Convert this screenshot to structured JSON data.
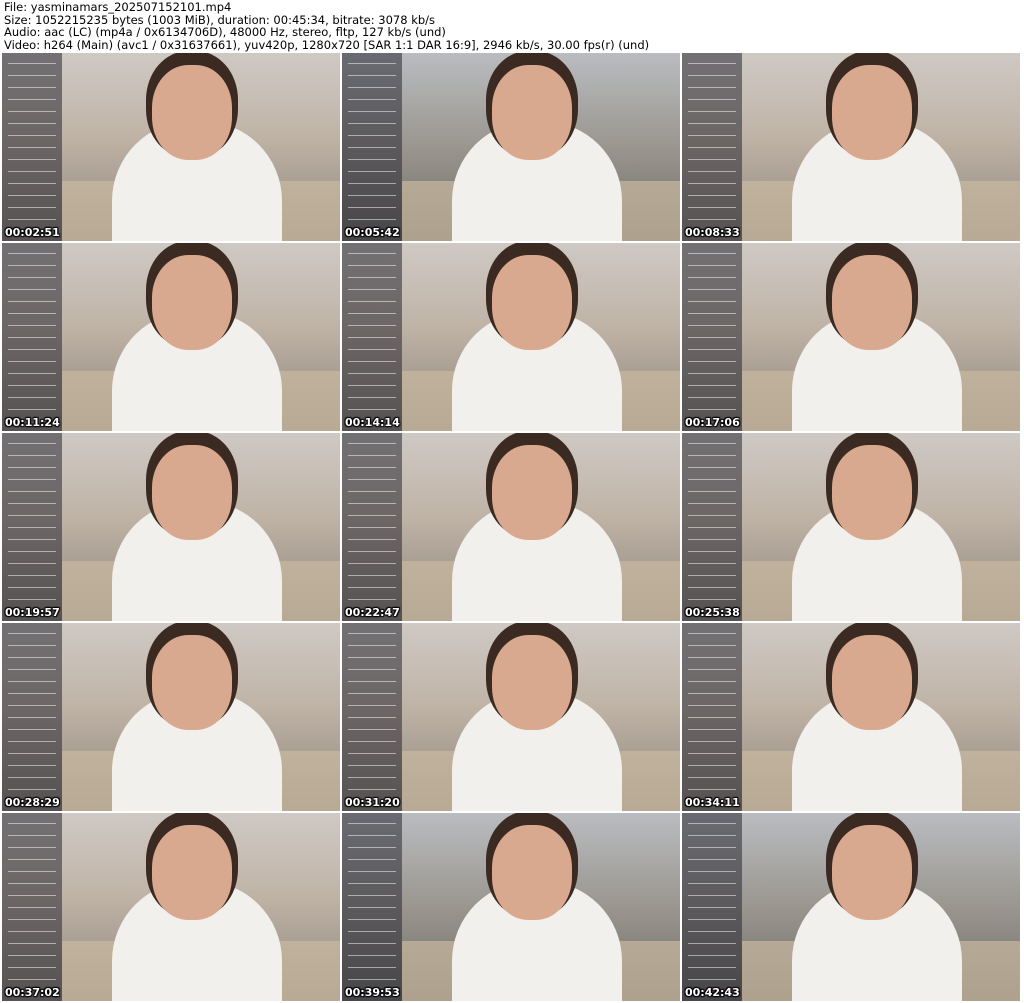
{
  "header": {
    "file": "File: yasminamars_202507152101.mp4",
    "size": "Size: 1052215235 bytes (1003 MiB), duration: 00:45:34, bitrate: 3078 kb/s",
    "audio": "Audio: aac (LC) (mp4a / 0x6134706D), 48000 Hz, stereo, fltp, 127 kb/s (und)",
    "video": "Video: h264 (Main) (avc1 / 0x31637661), yuv420p, 1280x720 [SAR 1:1 DAR 16:9], 2946 kb/s, 30.00 fps(r) (und)"
  },
  "thumbnails": [
    {
      "timestamp": "00:02:51"
    },
    {
      "timestamp": "00:05:42"
    },
    {
      "timestamp": "00:08:33"
    },
    {
      "timestamp": "00:11:24"
    },
    {
      "timestamp": "00:14:14"
    },
    {
      "timestamp": "00:17:06"
    },
    {
      "timestamp": "00:19:57"
    },
    {
      "timestamp": "00:22:47"
    },
    {
      "timestamp": "00:25:38"
    },
    {
      "timestamp": "00:28:29"
    },
    {
      "timestamp": "00:31:20"
    },
    {
      "timestamp": "00:34:11"
    },
    {
      "timestamp": "00:37:02"
    },
    {
      "timestamp": "00:39:53"
    },
    {
      "timestamp": "00:42:43"
    }
  ]
}
